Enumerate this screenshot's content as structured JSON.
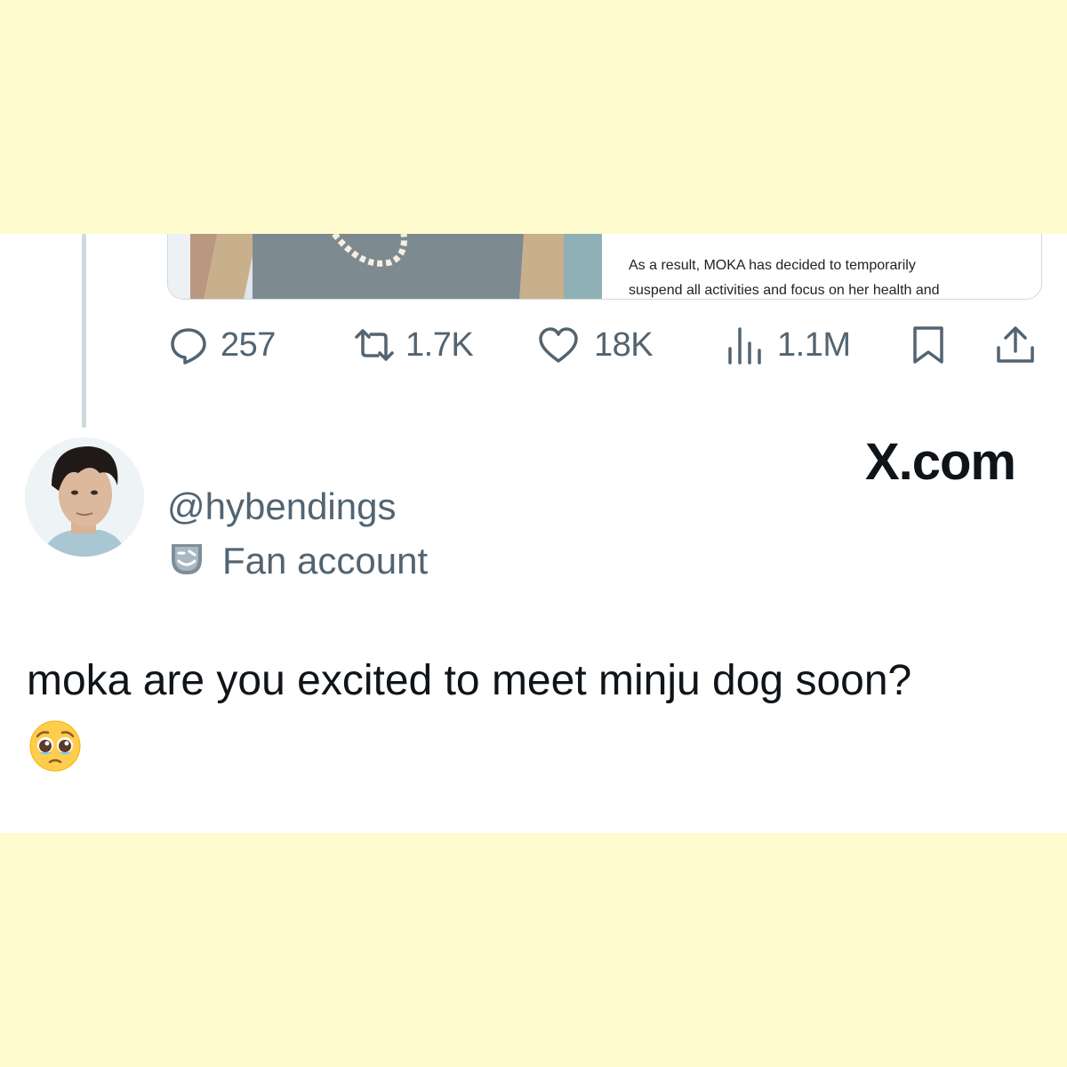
{
  "document_excerpt": {
    "lines": [
      "As a result, MOKA has decided to temporarily",
      "suspend all activities and focus on her health and"
    ]
  },
  "actions": {
    "replies": "257",
    "reposts": "1.7K",
    "likes": "18K",
    "views": "1.1M"
  },
  "author": {
    "handle": "@hybendings",
    "label": "Fan account"
  },
  "brand": "X.com",
  "tweet": {
    "text": "moka are you excited to meet minju dog soon?",
    "emoji": "pleading-face"
  },
  "icons": {
    "reply": "reply-icon",
    "repost": "repost-icon",
    "like": "like-icon",
    "views": "views-icon",
    "bookmark": "bookmark-icon",
    "share": "share-icon",
    "fan_label": "theater-masks-icon"
  },
  "colors": {
    "page_background": "#fefcce",
    "card_background": "#ffffff",
    "secondary_text": "#536471",
    "primary_text": "#0f1419",
    "border": "#cfd9de"
  }
}
